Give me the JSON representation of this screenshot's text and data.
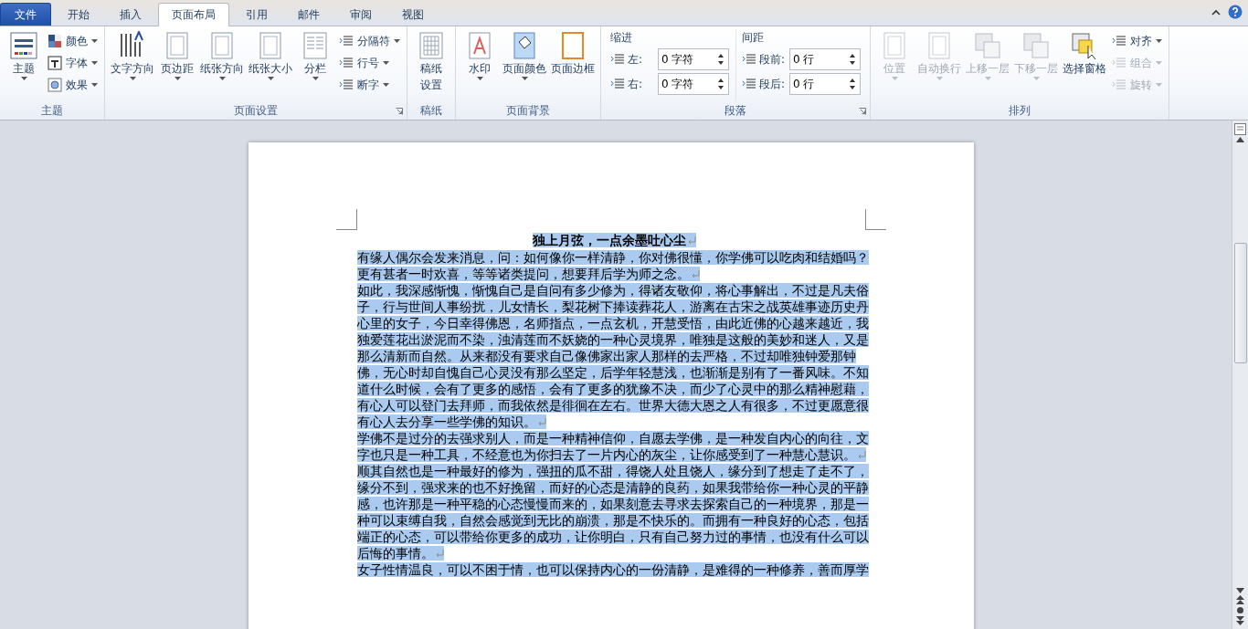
{
  "tabs": [
    {
      "label": "文件",
      "kind": "file",
      "selected": false
    },
    {
      "label": "开始",
      "kind": "tab",
      "selected": false
    },
    {
      "label": "插入",
      "kind": "tab",
      "selected": false
    },
    {
      "label": "页面布局",
      "kind": "tab",
      "selected": true
    },
    {
      "label": "引用",
      "kind": "tab",
      "selected": false
    },
    {
      "label": "邮件",
      "kind": "tab",
      "selected": false
    },
    {
      "label": "审阅",
      "kind": "tab",
      "selected": false
    },
    {
      "label": "视图",
      "kind": "tab",
      "selected": false
    }
  ],
  "ribbon": {
    "groups": [
      {
        "title": "主题",
        "launcher": false,
        "items": [
          {
            "kind": "large",
            "label_lines": [
              "主题"
            ],
            "dropdown": true,
            "disabled": false
          },
          {
            "kind": "stack",
            "items": [
              {
                "label": "颜色",
                "dropdown": true,
                "disabled": false
              },
              {
                "label": "字体",
                "dropdown": true,
                "disabled": false
              },
              {
                "label": "效果",
                "dropdown": true,
                "disabled": false
              }
            ]
          }
        ]
      },
      {
        "title": "页面设置",
        "launcher": true,
        "items": [
          {
            "kind": "large",
            "label_lines": [
              "文字方向"
            ],
            "dropdown": true,
            "disabled": false
          },
          {
            "kind": "large",
            "label_lines": [
              "页边距"
            ],
            "dropdown": true,
            "disabled": false
          },
          {
            "kind": "large",
            "label_lines": [
              "纸张方向"
            ],
            "dropdown": true,
            "disabled": false
          },
          {
            "kind": "large",
            "label_lines": [
              "纸张大小"
            ],
            "dropdown": true,
            "disabled": false
          },
          {
            "kind": "large",
            "label_lines": [
              "分栏"
            ],
            "dropdown": true,
            "disabled": false
          },
          {
            "kind": "stack",
            "items": [
              {
                "label": "分隔符",
                "dropdown": true,
                "disabled": false
              },
              {
                "label": "行号",
                "dropdown": true,
                "disabled": false
              },
              {
                "label": "断字",
                "dropdown": true,
                "disabled": false
              }
            ]
          }
        ]
      },
      {
        "title": "稿纸",
        "launcher": false,
        "items": [
          {
            "kind": "large",
            "label_lines": [
              "稿纸",
              "设置"
            ],
            "dropdown": false,
            "disabled": false
          }
        ]
      },
      {
        "title": "页面背景",
        "launcher": false,
        "items": [
          {
            "kind": "large",
            "label_lines": [
              "水印"
            ],
            "dropdown": true,
            "disabled": false
          },
          {
            "kind": "large",
            "label_lines": [
              "页面颜色"
            ],
            "dropdown": true,
            "disabled": false
          },
          {
            "kind": "large",
            "label_lines": [
              "页面边框"
            ],
            "dropdown": false,
            "disabled": false
          }
        ]
      },
      {
        "title": "段落",
        "launcher": true,
        "items": [
          {
            "kind": "fields",
            "heading": "缩进",
            "fields": [
              {
                "label": "左:",
                "value": "0 字符"
              },
              {
                "label": "右:",
                "value": "0 字符"
              }
            ]
          },
          {
            "kind": "fields",
            "heading": "间距",
            "fields": [
              {
                "label": "段前:",
                "value": "0 行"
              },
              {
                "label": "段后:",
                "value": "0 行"
              }
            ]
          }
        ]
      },
      {
        "title": "排列",
        "launcher": false,
        "items": [
          {
            "kind": "large",
            "label_lines": [
              "位置"
            ],
            "dropdown": true,
            "disabled": true
          },
          {
            "kind": "large",
            "label_lines": [
              "自动换行"
            ],
            "dropdown": true,
            "disabled": true
          },
          {
            "kind": "large",
            "label_lines": [
              "上移一层"
            ],
            "dropdown": true,
            "disabled": true
          },
          {
            "kind": "large",
            "label_lines": [
              "下移一层"
            ],
            "dropdown": true,
            "disabled": true
          },
          {
            "kind": "large",
            "label_lines": [
              "选择窗格"
            ],
            "dropdown": false,
            "disabled": false
          },
          {
            "kind": "stack",
            "items": [
              {
                "label": "对齐",
                "dropdown": true,
                "disabled": false
              },
              {
                "label": "组合",
                "dropdown": true,
                "disabled": true
              },
              {
                "label": "旋转",
                "dropdown": true,
                "disabled": true
              }
            ]
          }
        ]
      }
    ]
  },
  "document": {
    "paragraphs": [
      {
        "kind": "title",
        "text": "独上月弦，一点余墨吐心尘",
        "selected": true,
        "mark": true
      },
      {
        "kind": "body",
        "text": "有缘人偶尔会发来消息，问：如何像你一样清静，你对佛很懂，你学佛可以吃肉和结婚吗？更有甚者一时欢喜，等等诸类提问，想要拜后学为师之念。",
        "selected": true,
        "mark": true
      },
      {
        "kind": "body",
        "text": "如此，我深感惭愧，惭愧自己是自问有多少修为，得诸友敬仰，将心事解出，不过是凡夫俗子，行与世间人事纷扰，儿女情长，梨花树下捧读葬花人，游离在古宋之战英雄事迹历史丹心里的女子，今日幸得佛恩，名师指点，一点玄机，开慧受悟，由此近佛的心越来越近，我独爱莲花出淤泥而不染，浊清莲而不妖娆的一种心灵境界，唯独是这般的美妙和迷人，又是那么清新而自然。从来都没有要求自己像佛家出家人那样的去严格，不过却唯独钟爱那钟佛，无心时却自愧自己心灵没有那么坚定，后学年轻慧浅，也渐渐是别有了一番风味。不知道什么时候，会有了更多的感悟，会有了更多的犹豫不决，而少了心灵中的那么精神慰藉，有心人可以登门去拜师，而我依然是徘徊在左右。世界大德大恩之人有很多，不过更愿意很有心人去分享一些学佛的知识。",
        "selected": true,
        "mark": true
      },
      {
        "kind": "body",
        "text": "学佛不是过分的去强求别人，而是一种精神信仰，自愿去学佛，是一种发自内心的向往，文字也只是一种工具，不经意也为你扫去了一片内心的灰尘，让你感受到了一种慧心慧识。",
        "selected": true,
        "mark": true
      },
      {
        "kind": "body",
        "text": "顺其自然也是一种最好的修为，强扭的瓜不甜，得饶人处且饶人，缘分到了想走了走不了，缘分不到，强求来的也不好挽留，而好的心态是清静的良药，如果我带给你一种心灵的平静感，也许那是一种平稳的心态慢慢而来的，如果刻意去寻求去探索自己的一种境界，那是一种可以束缚自我，自然会感觉到无比的崩溃，那是不快乐的。而拥有一种良好的心态，包括端正的心态，可以带给你更多的成功，让你明白，只有自己努力过的事情，也没有什么可以后悔的事情。",
        "selected": true,
        "mark": true
      },
      {
        "kind": "body",
        "text": "女子性情温良，可以不困于情，也可以保持内心的一份清静，是难得的一种修养，善而厚学",
        "selected": true,
        "mark": false
      }
    ]
  }
}
